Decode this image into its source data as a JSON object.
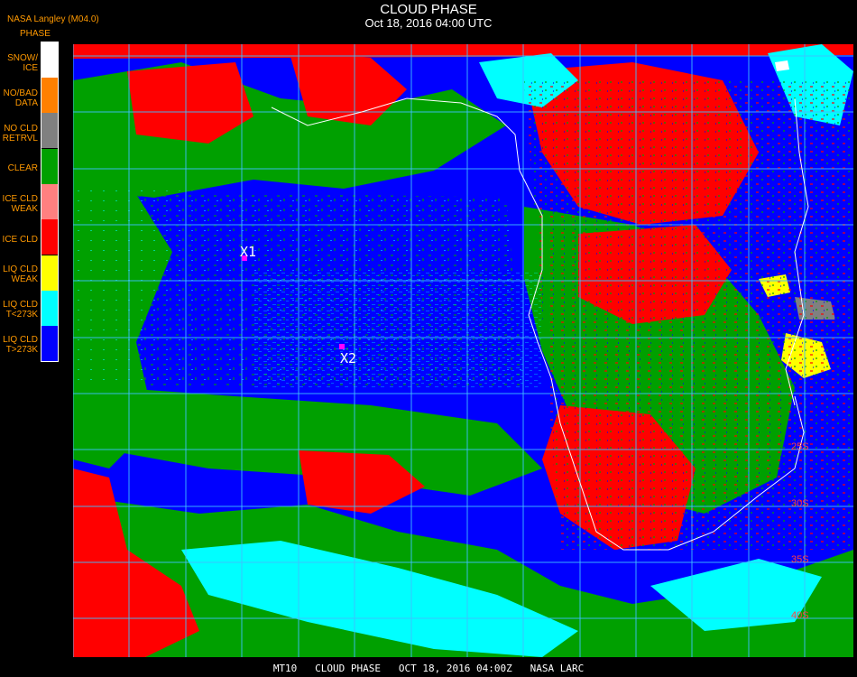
{
  "header": {
    "producer": "NASA Langley (M04.0)",
    "title": "CLOUD PHASE",
    "subtitle": "Oct 18, 2016 04:00 UTC"
  },
  "legend": {
    "title": "PHASE",
    "items": [
      {
        "label": "SNOW/\nICE",
        "color": "#ffffff"
      },
      {
        "label": "NO/BAD\nDATA",
        "color": "#ff8000"
      },
      {
        "label": "NO CLD\nRETRVL",
        "color": "#808080"
      },
      {
        "label": "CLEAR",
        "color": "#00a000"
      },
      {
        "label": "ICE CLD\nWEAK",
        "color": "#ff8080"
      },
      {
        "label": "ICE CLD",
        "color": "#ff0000"
      },
      {
        "label": "LIQ CLD\nWEAK",
        "color": "#ffff00"
      },
      {
        "label": "LIQ CLD\nT<273K",
        "color": "#00ffff"
      },
      {
        "label": "LIQ CLD\nT>273K",
        "color": "#0000ff"
      }
    ]
  },
  "map": {
    "markers": [
      {
        "label": "X1",
        "color": "#ff00ff"
      },
      {
        "label": "X2",
        "color": "#ff00ff"
      }
    ],
    "lat_labels": [
      "25S",
      "30S",
      "35S",
      "40S"
    ],
    "grid_color": "#40c0ff",
    "coast_color": "#ffffff"
  },
  "footer": "MT10   CLOUD PHASE   OCT 18, 2016 04:00Z   NASA LARC"
}
